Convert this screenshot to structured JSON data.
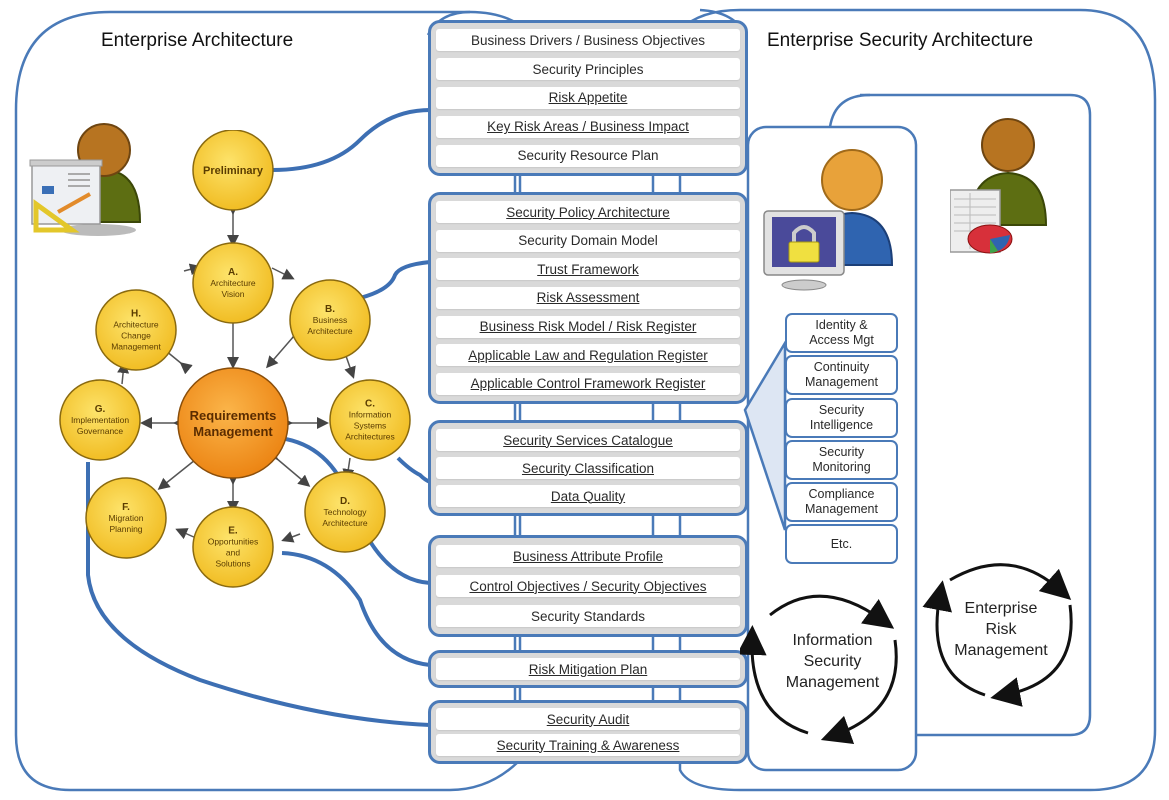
{
  "titles": {
    "left": "Enterprise Architecture",
    "right": "Enterprise Security Architecture"
  },
  "colors": {
    "frame_blue": "#4a7ab8",
    "node_yellow": "#f5c431",
    "node_center_orange": "#f29a22",
    "stack_gray": "#d9d9d9"
  },
  "togaf": {
    "preliminary": "Preliminary",
    "center": [
      "Requirements",
      "Management"
    ],
    "phases": [
      {
        "letter": "A.",
        "lines": [
          "Architecture",
          "Vision"
        ]
      },
      {
        "letter": "B.",
        "lines": [
          "Business",
          "Architecture"
        ]
      },
      {
        "letter": "C.",
        "lines": [
          "Information",
          "Systems",
          "Architectures"
        ]
      },
      {
        "letter": "D.",
        "lines": [
          "Technology",
          "Architecture"
        ]
      },
      {
        "letter": "E.",
        "lines": [
          "Opportunities",
          "and",
          "Solutions"
        ]
      },
      {
        "letter": "F.",
        "lines": [
          "Migration",
          "Planning"
        ]
      },
      {
        "letter": "G.",
        "lines": [
          "Implementation",
          "Governance"
        ]
      },
      {
        "letter": "H.",
        "lines": [
          "Architecture",
          "Change",
          "Management"
        ]
      }
    ]
  },
  "stacks": [
    {
      "items": [
        {
          "label": "Business Drivers / Business Objectives",
          "underlined": false
        },
        {
          "label": "Security Principles",
          "underlined": false
        },
        {
          "label": "Risk Appetite",
          "underlined": true
        },
        {
          "label": "Key Risk Areas / Business Impact",
          "underlined": true
        },
        {
          "label": "Security Resource Plan",
          "underlined": false
        }
      ]
    },
    {
      "items": [
        {
          "label": "Security Policy Architecture",
          "underlined": true
        },
        {
          "label": "Security Domain Model",
          "underlined": false
        },
        {
          "label": "Trust Framework",
          "underlined": true
        },
        {
          "label": "Risk Assessment",
          "underlined": true
        },
        {
          "label": "Business Risk Model / Risk Register",
          "underlined": true
        },
        {
          "label": "Applicable Law and Regulation Register",
          "underlined": true
        },
        {
          "label": "Applicable Control Framework Register",
          "underlined": true
        }
      ]
    },
    {
      "items": [
        {
          "label": "Security Services Catalogue",
          "underlined": true
        },
        {
          "label": "Security Classification",
          "underlined": true
        },
        {
          "label": "Data Quality",
          "underlined": true
        }
      ]
    },
    {
      "items": [
        {
          "label": "Business Attribute Profile",
          "underlined": true
        },
        {
          "label": "Control Objectives / Security Objectives",
          "underlined": true
        },
        {
          "label": "Security Standards",
          "underlined": false
        }
      ]
    },
    {
      "items": [
        {
          "label": "Risk Mitigation Plan",
          "underlined": true
        }
      ]
    },
    {
      "items": [
        {
          "label": "Security Audit",
          "underlined": true
        },
        {
          "label": "Security Training & Awareness",
          "underlined": true
        }
      ]
    }
  ],
  "services": [
    {
      "lines": [
        "Identity &",
        "Access Mgt"
      ]
    },
    {
      "lines": [
        "Continuity",
        "Management"
      ]
    },
    {
      "lines": [
        "Security",
        "Intelligence"
      ]
    },
    {
      "lines": [
        "Security",
        "Monitoring"
      ]
    },
    {
      "lines": [
        "Compliance",
        "Management"
      ]
    },
    {
      "lines": [
        "Etc."
      ]
    }
  ],
  "cycles": {
    "ism": [
      "Information",
      "Security",
      "Management"
    ],
    "erm": [
      "Enterprise",
      "Risk",
      "Management"
    ]
  },
  "icons": {
    "architect": "architect-person-icon",
    "security_officer": "security-officer-lock-icon",
    "risk_manager": "risk-manager-chart-icon"
  }
}
